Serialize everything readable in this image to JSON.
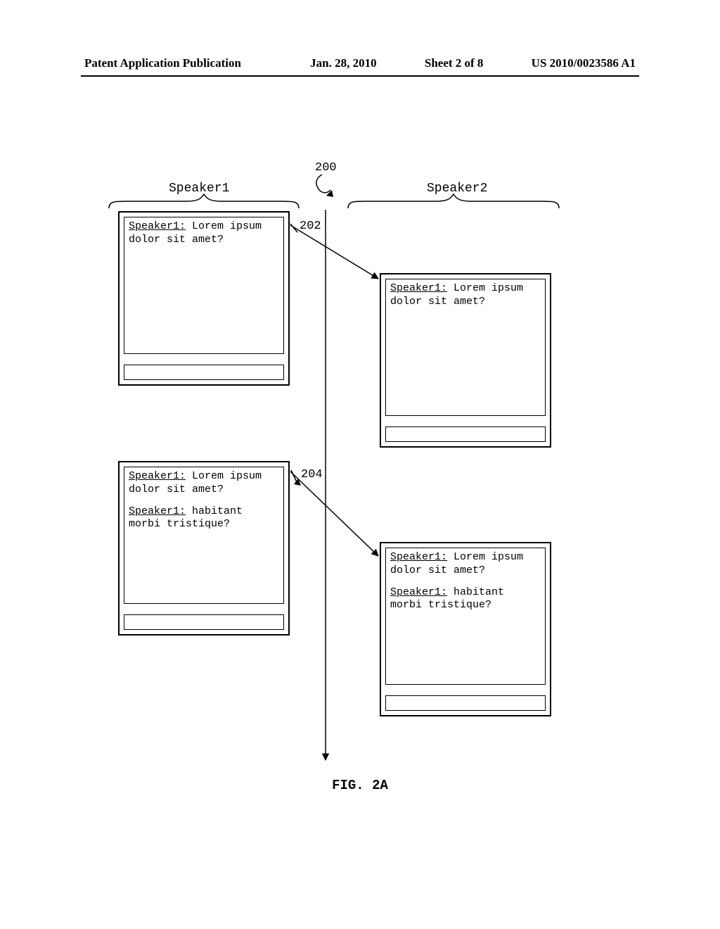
{
  "header": {
    "pub_label": "Patent Application Publication",
    "date": "Jan. 28, 2010",
    "sheet": "Sheet 2 of 8",
    "code": "US 2010/0023586 A1"
  },
  "columns": {
    "left_label": "Speaker1",
    "right_label": "Speaker2"
  },
  "refs": {
    "r200": "200",
    "r202": "202",
    "r204": "204"
  },
  "panes": {
    "p1": {
      "msgs": [
        {
          "speaker": "Speaker1:",
          "text": "  Lorem ipsum dolor sit amet?"
        }
      ]
    },
    "p2": {
      "msgs": [
        {
          "speaker": "Speaker1:",
          "text": "  Lorem ipsum dolor sit amet?"
        }
      ]
    },
    "p3": {
      "msgs": [
        {
          "speaker": "Speaker1:",
          "text": "  Lorem ipsum dolor sit amet?"
        },
        {
          "speaker": "Speaker1:",
          "text": " habitant morbi tristique?"
        }
      ]
    },
    "p4": {
      "msgs": [
        {
          "speaker": "Speaker1:",
          "text": "  Lorem ipsum dolor sit amet?"
        },
        {
          "speaker": "Speaker1:",
          "text": " habitant morbi tristique?"
        }
      ]
    }
  },
  "figure_caption": "FIG.  2A"
}
